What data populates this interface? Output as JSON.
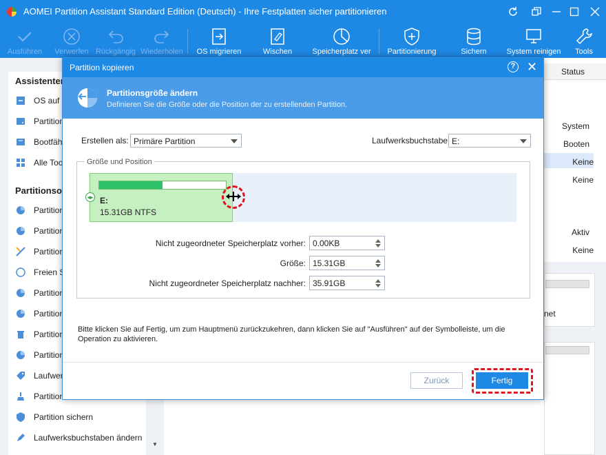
{
  "window": {
    "title": "AOMEI Partition Assistant Standard Edition (Deutsch) - Ihre Festplatten sicher partitionieren",
    "controls": [
      "refresh-icon",
      "minimize-icon",
      "maximize-icon",
      "close-icon"
    ]
  },
  "toolbar": {
    "apply": "Ausführen",
    "discard": "Verwerfen",
    "undo": "Rückgängig",
    "redo": "Wiederholen",
    "migrate_os": "OS migrieren",
    "wipe": "Wischen",
    "free_space": "Speicherplatz ver",
    "partitioning": "Partitionierung",
    "backup": "Sichern",
    "clean": "System reinigen",
    "tools": "Tools"
  },
  "sidebar": {
    "wizards_header": "Assistenten",
    "wizards": [
      {
        "label": "OS auf S",
        "icon": "migrate-icon"
      },
      {
        "label": "Partition",
        "icon": "disk-icon"
      },
      {
        "label": "Bootfähi",
        "icon": "boot-disk-icon"
      },
      {
        "label": "Alle Tool",
        "icon": "tools-grid-icon"
      }
    ],
    "partition_ops_header": "Partitionsop",
    "partition_ops": [
      {
        "label": "Partition",
        "icon": "partition-pie-icon"
      },
      {
        "label": "Partition",
        "icon": "partition-pie-icon"
      },
      {
        "label": "Partition",
        "icon": "split-icon"
      },
      {
        "label": "Freien Sp",
        "icon": "free-space-icon"
      },
      {
        "label": "Partition",
        "icon": "partition-pie-icon"
      },
      {
        "label": "Partition",
        "icon": "partition-pie-icon"
      },
      {
        "label": "Partition",
        "icon": "trash-icon"
      },
      {
        "label": "Partition",
        "icon": "partition-pie-icon"
      },
      {
        "label": "Laufwerk",
        "icon": "tag-icon"
      },
      {
        "label": "Partition",
        "icon": "wipe-brush-icon"
      },
      {
        "label": "Partition sichern",
        "icon": "shield-icon"
      },
      {
        "label": "Laufwerksbuchstaben ändern",
        "icon": "pen-icon"
      }
    ]
  },
  "status_list": {
    "header": "Status",
    "values": [
      "System",
      "Booten",
      "Keine",
      "Keine",
      "Aktiv",
      "Keine"
    ],
    "fragment": "net"
  },
  "dialog": {
    "title": "Partition kopieren",
    "banner_title": "Partitionsgröße ändern",
    "banner_subtitle": "Definieren Sie die Größe oder die Position der zu erstellenden Partition.",
    "create_as_label": "Erstellen als:",
    "create_as_value": "Primäre Partition",
    "drive_letter_label": "Laufwerksbuchstabe:",
    "drive_letter_value": "E:",
    "group_title": "Größe und Position",
    "partition": {
      "letter": "E:",
      "info": "15.31GB NTFS",
      "used_fraction": 0.5
    },
    "fields": {
      "before_label": "Nicht zugeordneter Speicherplatz vorher:",
      "before_value": "0.00KB",
      "size_label": "Größe:",
      "size_value": "15.31GB",
      "after_label": "Nicht zugeordneter Speicherplatz nachher:",
      "after_value": "35.91GB"
    },
    "hint": "Bitte klicken Sie auf Fertig, um zum Hauptmenü zurückzukehren, dann klicken Sie auf \"Ausführen\" auf der Symbolleiste, um die Operation zu aktivieren.",
    "back_label": "Zurück",
    "finish_label": "Fertig"
  },
  "colors": {
    "accent": "#1e88e5",
    "partition_fill": "#c6efc2",
    "usage_fill": "#2ec16b",
    "highlight": "#e0141e"
  }
}
